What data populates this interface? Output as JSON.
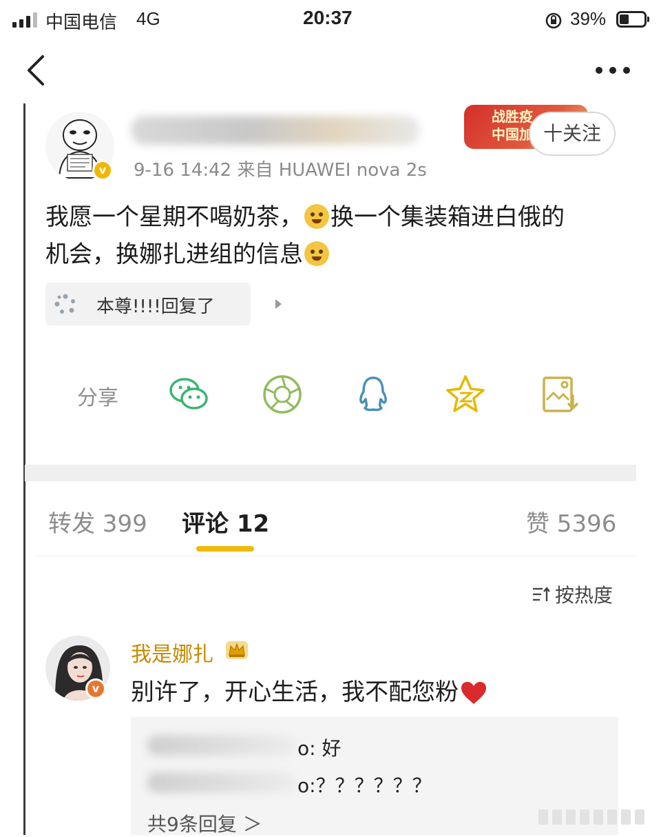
{
  "status_bar": {
    "carrier": "中国电信",
    "network": "4G",
    "time": "20:37",
    "battery_percent": "39%",
    "battery_level": 0.39
  },
  "nav": {
    "back_icon": "chevron-left-icon",
    "more_icon": "more-dots-icon"
  },
  "post": {
    "meta": "9-16 14:42  来自 HUAWEI nova 2s",
    "promo_text": "战胜疫 中国加",
    "follow_label": "十关注",
    "text_line1_a": "我愿一个星期不喝奶茶，",
    "text_line1_b": "换一个集装箱进白俄的",
    "text_line2": "机会，换娜扎进组的信息",
    "reply_chip": "本尊!!!!回复了"
  },
  "share": {
    "label": "分享",
    "icons": [
      "wechat-icon",
      "moments-icon",
      "qq-icon",
      "qzone-star-icon",
      "save-image-icon"
    ]
  },
  "tabs": {
    "repost": "转发 399",
    "comments": "评论 12",
    "likes": "赞 5396"
  },
  "sort": {
    "label": "按热度"
  },
  "comment": {
    "author": "我是娜扎",
    "text": "别许了，开心生活，我不配您粉",
    "replies": [
      {
        "suffix": "o: 好"
      },
      {
        "suffix": "o:？？？？？？"
      }
    ],
    "replies_total": "共9条回复 ＞"
  },
  "colors": {
    "accent_gold": "#f0b90b",
    "username_gold": "#c58a00",
    "share_green": "#3cb371",
    "promo_red": "#d4302b"
  }
}
